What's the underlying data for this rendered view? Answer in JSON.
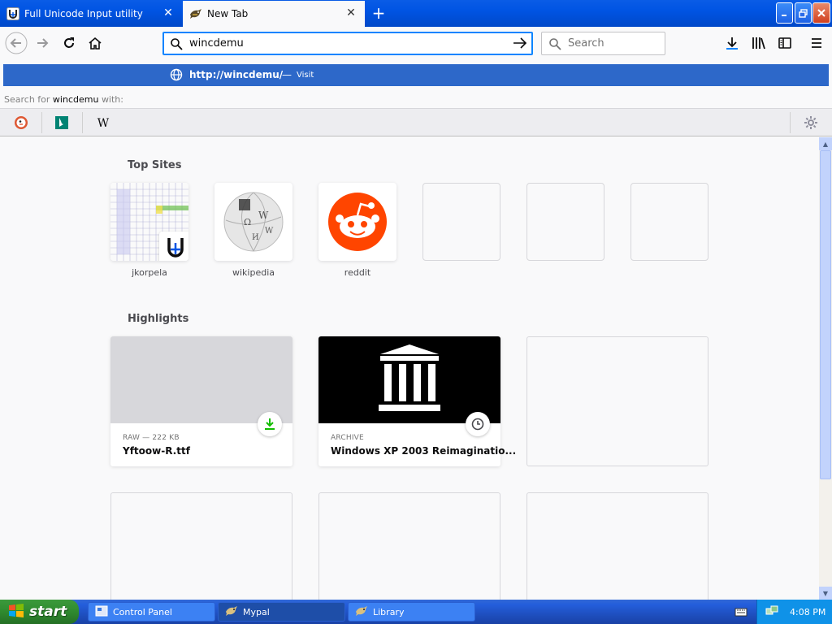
{
  "browser": {
    "tabs": [
      {
        "title": "Full Unicode Input utility",
        "icon": "unicode-u-icon",
        "active": false
      },
      {
        "title": "New Tab",
        "icon": "mypal-bird-icon",
        "active": true
      }
    ],
    "urlbar": {
      "value": "wincdemu"
    },
    "searchbar": {
      "placeholder": "Search"
    },
    "autocomplete": {
      "url": "http://wincdemu/",
      "separator": "—",
      "action": "Visit"
    },
    "search_for": {
      "prefix": "Search for",
      "term": "wincdemu",
      "suffix": "with:"
    },
    "engines": [
      "duckduckgo-icon",
      "bing-icon",
      "wikipedia-w-icon"
    ]
  },
  "newtab": {
    "top_sites_title": "Top Sites",
    "top_sites": [
      {
        "label": "jkorpela"
      },
      {
        "label": "wikipedia"
      },
      {
        "label": "reddit"
      },
      {
        "label": ""
      },
      {
        "label": ""
      },
      {
        "label": ""
      }
    ],
    "highlights_title": "Highlights",
    "highlights": [
      {
        "context": "RAW — 222 KB",
        "title": "Yftoow-R.ttf",
        "badge": "download-icon"
      },
      {
        "context": "ARCHIVE",
        "title": "Windows XP 2003 Reimaginatio...",
        "badge": "clock-icon"
      }
    ]
  },
  "taskbar": {
    "start_label": "start",
    "tasks": [
      {
        "label": "Control Panel",
        "active": false
      },
      {
        "label": "Mypal",
        "active": true
      },
      {
        "label": "Library",
        "active": false
      }
    ],
    "clock": "4:08 PM"
  },
  "colors": {
    "xp_blue": "#0054e3",
    "accent": "#0a84ff",
    "autocomplete_bg": "#2d68c9",
    "reddit": "#ff4500",
    "download_green": "#12bc00"
  }
}
